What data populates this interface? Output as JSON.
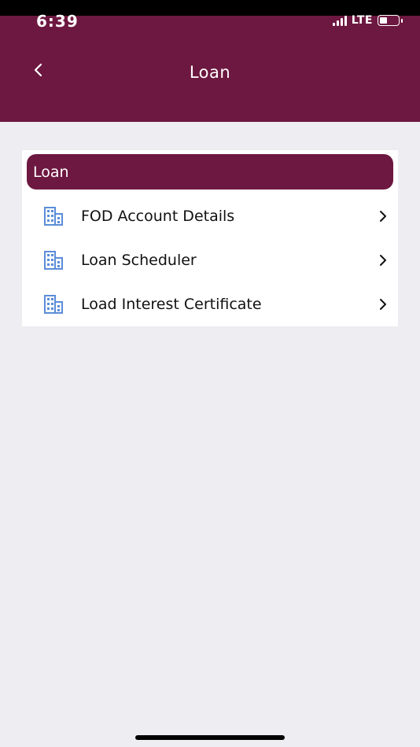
{
  "status_bar": {
    "time": "6:39",
    "network": "LTE"
  },
  "header": {
    "title": "Loan",
    "back_icon": "chevron-left-icon"
  },
  "colors": {
    "brand": "#6d1840",
    "icon_blue": "#5b8dd9",
    "background": "#eeedf2"
  },
  "section": {
    "title": "Loan",
    "items": [
      {
        "label": "FOD Account Details",
        "icon": "building-icon"
      },
      {
        "label": "Loan Scheduler",
        "icon": "building-icon"
      },
      {
        "label": "Load Interest Certificate",
        "icon": "building-icon"
      }
    ]
  }
}
